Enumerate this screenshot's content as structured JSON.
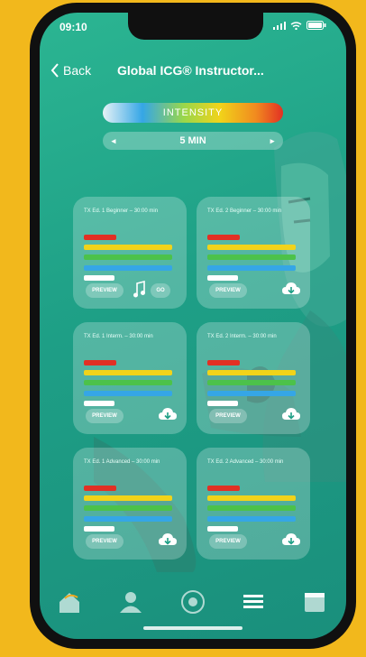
{
  "status_bar": {
    "time": "09:10"
  },
  "header": {
    "back_label": "Back",
    "title": "Global ICG® Instructor..."
  },
  "intensity": {
    "label": "INTENSITY"
  },
  "duration": {
    "value": "5 MIN",
    "prev_arrow": "◂",
    "next_arrow": "▸"
  },
  "workouts": [
    {
      "title": "TX Ed. 1 Beginner – 30:00 min",
      "preview_label": "PREVIEW",
      "action": "go",
      "go_label": "GO",
      "bars": [
        "red",
        "yellow",
        "green",
        "blue",
        "white"
      ]
    },
    {
      "title": "TX Ed. 2 Beginner – 30:00 min",
      "preview_label": "PREVIEW",
      "action": "download",
      "bars": [
        "red",
        "yellow",
        "green",
        "blue",
        "white"
      ]
    },
    {
      "title": "TX Ed. 1 Interm. – 30:00 min",
      "preview_label": "PREVIEW",
      "action": "download",
      "bars": [
        "red",
        "yellow",
        "green",
        "blue",
        "white"
      ]
    },
    {
      "title": "TX Ed. 2 Interm. – 30:00 min",
      "preview_label": "PREVIEW",
      "action": "download",
      "bars": [
        "red",
        "yellow",
        "green",
        "blue",
        "white"
      ]
    },
    {
      "title": "TX Ed. 1 Advanced – 30:00 min",
      "preview_label": "PREVIEW",
      "action": "download",
      "bars": [
        "red",
        "yellow",
        "green",
        "blue",
        "white"
      ]
    },
    {
      "title": "TX Ed. 2 Advanced – 30:00 min",
      "preview_label": "PREVIEW",
      "action": "download",
      "bars": [
        "red",
        "yellow",
        "green",
        "blue",
        "white"
      ]
    }
  ],
  "tab_bar": {
    "items": [
      "home-icon",
      "profile-icon",
      "record-icon",
      "list-icon",
      "calendar-icon"
    ]
  },
  "colors": {
    "red": "#e23024",
    "yellow": "#f1d31a",
    "green": "#4cc24a",
    "blue": "#35a6e6",
    "white": "#ffffff",
    "background": "#f2b81c"
  }
}
